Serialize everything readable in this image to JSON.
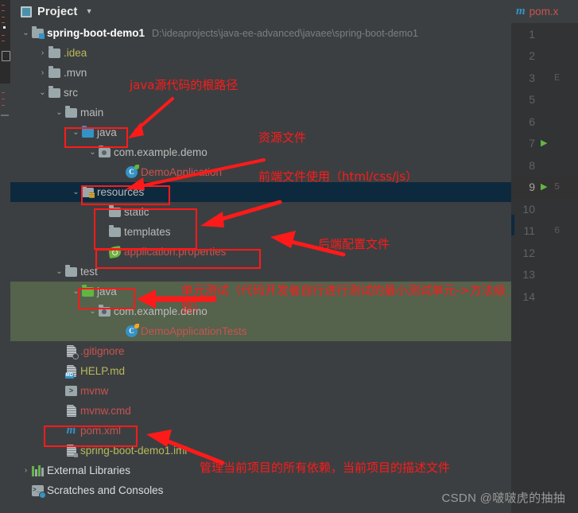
{
  "window": {
    "panel_title": "Project",
    "panel_chevron": "▼",
    "project_icon": "project-icon"
  },
  "tree": {
    "root": {
      "label": "spring-boot-demo1",
      "path": "D:\\ideaprojects\\java-ee-advanced\\javaee\\spring-boot-demo1"
    },
    "nodes": [
      {
        "label": ".idea",
        "arrow": "›",
        "icon": "folder",
        "color": "yellow"
      },
      {
        "label": ".mvn",
        "arrow": "›",
        "icon": "folder",
        "color": "default"
      },
      {
        "label": "src",
        "arrow": "⌄",
        "icon": "folder",
        "color": "default"
      },
      {
        "label": "main",
        "arrow": "⌄",
        "icon": "folder",
        "color": "default"
      },
      {
        "label": "java",
        "arrow": "⌄",
        "icon": "folder-source",
        "color": "default"
      },
      {
        "label": "com.example.demo",
        "arrow": "⌄",
        "icon": "package",
        "color": "default"
      },
      {
        "label": "DemoApplication",
        "arrow": "",
        "icon": "java-class",
        "color": "red"
      },
      {
        "label": "resources",
        "arrow": "⌄",
        "icon": "folder-resource",
        "color": "default"
      },
      {
        "label": "static",
        "arrow": "",
        "icon": "folder",
        "color": "default"
      },
      {
        "label": "templates",
        "arrow": "",
        "icon": "folder",
        "color": "default"
      },
      {
        "label": "application.properties",
        "arrow": "",
        "icon": "spring-leaf",
        "color": "red"
      },
      {
        "label": "test",
        "arrow": "⌄",
        "icon": "folder",
        "color": "default"
      },
      {
        "label": "java",
        "arrow": "⌄",
        "icon": "folder-test",
        "color": "default"
      },
      {
        "label": "com.example.demo",
        "arrow": "⌄",
        "icon": "package",
        "color": "default"
      },
      {
        "label": "DemoApplicationTests",
        "arrow": "",
        "icon": "test-class",
        "color": "red"
      },
      {
        "label": ".gitignore",
        "arrow": "",
        "icon": "gitignore-file",
        "color": "red"
      },
      {
        "label": "HELP.md",
        "arrow": "",
        "icon": "markdown-file",
        "color": "yellow"
      },
      {
        "label": "mvnw",
        "arrow": "",
        "icon": "shell-file",
        "color": "red"
      },
      {
        "label": "mvnw.cmd",
        "arrow": "",
        "icon": "text-file",
        "color": "red"
      },
      {
        "label": "pom.xml",
        "arrow": "",
        "icon": "maven-file",
        "color": "red"
      },
      {
        "label": "spring-boot-demo1.iml",
        "arrow": "",
        "icon": "iml-file",
        "color": "yellow"
      },
      {
        "label": "External Libraries",
        "arrow": "›",
        "icon": "libraries",
        "color": "white"
      },
      {
        "label": "Scratches and Consoles",
        "arrow": "",
        "icon": "scratches",
        "color": "white"
      }
    ]
  },
  "editor": {
    "tab_label": "pom.x",
    "tab_icon": "maven-icon",
    "line_numbers": [
      "1",
      "2",
      "3",
      "5",
      "6",
      "7",
      "8",
      "9",
      "10",
      "11",
      "12",
      "13",
      "14"
    ],
    "current_line": "9",
    "run_marker_lines": [
      "7",
      "9"
    ],
    "code_hints": {
      "3": "E",
      "9": "5",
      "11": "6"
    }
  },
  "annotations": [
    {
      "id": "java-src-root",
      "text": "java源代码的根路径"
    },
    {
      "id": "resources-note",
      "text": "资源文件"
    },
    {
      "id": "frontend-note",
      "text": "前端文件使用（html/css/js）"
    },
    {
      "id": "backend-config-note",
      "text": "后端配置文件"
    },
    {
      "id": "unit-test-note-l1",
      "text": "单元测试（代码开发者自行进行测试的最小测试单元->方法级"
    },
    {
      "id": "unit-test-note-l2",
      "text": "别）"
    },
    {
      "id": "pom-note",
      "text": "管理当前项目的所有依赖，当前项目的描述文件"
    }
  ],
  "watermark": "CSDN @啵啵虎的抽抽",
  "colors": {
    "annotation_red": "#ff1a1a",
    "selection_blue": "#0d293e",
    "test_green": "#55624c",
    "panel_bg": "#3c3f41",
    "editor_bg": "#313335"
  }
}
